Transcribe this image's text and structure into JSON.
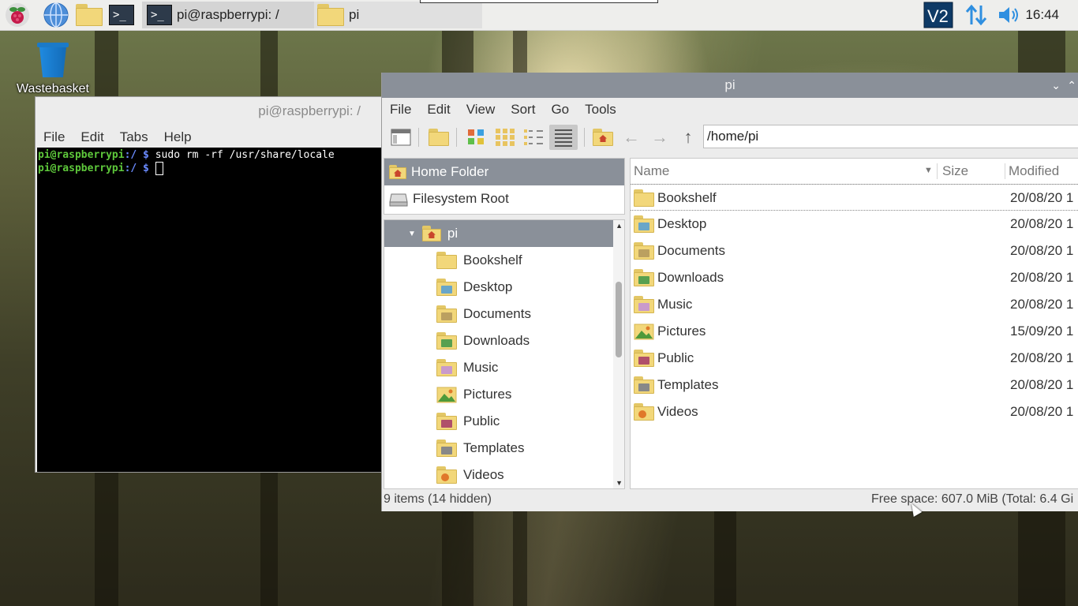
{
  "panel": {
    "tasks": [
      {
        "label": "pi@raspberrypi: /"
      },
      {
        "label": "pi"
      }
    ],
    "clock": "16:44"
  },
  "desktop": {
    "wastebasket_label": "Wastebasket"
  },
  "terminal": {
    "title": "pi@raspberrypi: /",
    "menu": [
      "File",
      "Edit",
      "Tabs",
      "Help"
    ],
    "lines": [
      {
        "prompt": "pi@raspberrypi",
        "path": ":/ $",
        "cmd": " sudo rm -rf /usr/share/locale"
      },
      {
        "prompt": "pi@raspberrypi",
        "path": ":/ $",
        "cmd": " "
      }
    ]
  },
  "filemanager": {
    "title": "pi",
    "menu": [
      "File",
      "Edit",
      "View",
      "Sort",
      "Go",
      "Tools"
    ],
    "path": "/home/pi",
    "places": [
      "Home Folder",
      "Filesystem Root"
    ],
    "tree_root": "pi",
    "tree_items": [
      "Bookshelf",
      "Desktop",
      "Documents",
      "Downloads",
      "Music",
      "Pictures",
      "Public",
      "Templates",
      "Videos"
    ],
    "columns": {
      "name": "Name",
      "size": "Size",
      "modified": "Modified"
    },
    "files": [
      {
        "name": "Bookshelf",
        "modified": "20/08/20 1"
      },
      {
        "name": "Desktop",
        "modified": "20/08/20 1"
      },
      {
        "name": "Documents",
        "modified": "20/08/20 1"
      },
      {
        "name": "Downloads",
        "modified": "20/08/20 1"
      },
      {
        "name": "Music",
        "modified": "20/08/20 1"
      },
      {
        "name": "Pictures",
        "modified": "15/09/20 1"
      },
      {
        "name": "Public",
        "modified": "20/08/20 1"
      },
      {
        "name": "Templates",
        "modified": "20/08/20 1"
      },
      {
        "name": "Videos",
        "modified": "20/08/20 1"
      }
    ],
    "status_left": "9 items (14 hidden)",
    "status_right": "Free space: 607.0 MiB (Total: 6.4 Gi"
  },
  "colors": {
    "panel_bg": "#eeeeec",
    "selection": "#8a9099",
    "terminal_prompt": "#5ec83b",
    "terminal_path": "#6a8bff",
    "folder": "#f2d77a"
  }
}
